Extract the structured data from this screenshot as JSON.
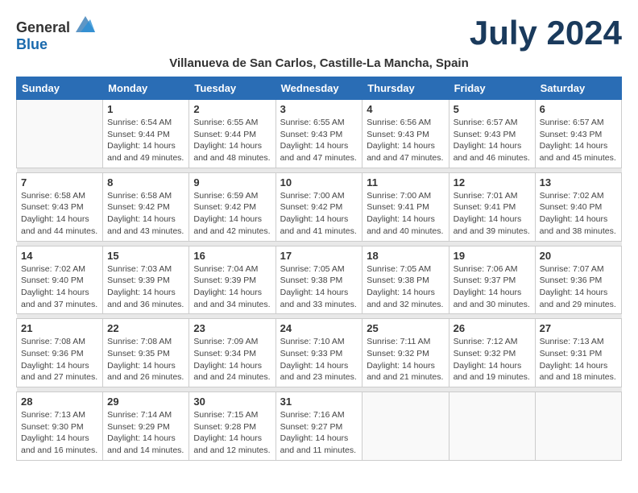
{
  "header": {
    "logo_general": "General",
    "logo_blue": "Blue",
    "month_title": "July 2024",
    "location": "Villanueva de San Carlos, Castille-La Mancha, Spain"
  },
  "days_of_week": [
    "Sunday",
    "Monday",
    "Tuesday",
    "Wednesday",
    "Thursday",
    "Friday",
    "Saturday"
  ],
  "weeks": [
    [
      {
        "day": "",
        "sunrise": "",
        "sunset": "",
        "daylight": ""
      },
      {
        "day": "1",
        "sunrise": "Sunrise: 6:54 AM",
        "sunset": "Sunset: 9:44 PM",
        "daylight": "Daylight: 14 hours and 49 minutes."
      },
      {
        "day": "2",
        "sunrise": "Sunrise: 6:55 AM",
        "sunset": "Sunset: 9:44 PM",
        "daylight": "Daylight: 14 hours and 48 minutes."
      },
      {
        "day": "3",
        "sunrise": "Sunrise: 6:55 AM",
        "sunset": "Sunset: 9:43 PM",
        "daylight": "Daylight: 14 hours and 47 minutes."
      },
      {
        "day": "4",
        "sunrise": "Sunrise: 6:56 AM",
        "sunset": "Sunset: 9:43 PM",
        "daylight": "Daylight: 14 hours and 47 minutes."
      },
      {
        "day": "5",
        "sunrise": "Sunrise: 6:57 AM",
        "sunset": "Sunset: 9:43 PM",
        "daylight": "Daylight: 14 hours and 46 minutes."
      },
      {
        "day": "6",
        "sunrise": "Sunrise: 6:57 AM",
        "sunset": "Sunset: 9:43 PM",
        "daylight": "Daylight: 14 hours and 45 minutes."
      }
    ],
    [
      {
        "day": "7",
        "sunrise": "Sunrise: 6:58 AM",
        "sunset": "Sunset: 9:43 PM",
        "daylight": "Daylight: 14 hours and 44 minutes."
      },
      {
        "day": "8",
        "sunrise": "Sunrise: 6:58 AM",
        "sunset": "Sunset: 9:42 PM",
        "daylight": "Daylight: 14 hours and 43 minutes."
      },
      {
        "day": "9",
        "sunrise": "Sunrise: 6:59 AM",
        "sunset": "Sunset: 9:42 PM",
        "daylight": "Daylight: 14 hours and 42 minutes."
      },
      {
        "day": "10",
        "sunrise": "Sunrise: 7:00 AM",
        "sunset": "Sunset: 9:42 PM",
        "daylight": "Daylight: 14 hours and 41 minutes."
      },
      {
        "day": "11",
        "sunrise": "Sunrise: 7:00 AM",
        "sunset": "Sunset: 9:41 PM",
        "daylight": "Daylight: 14 hours and 40 minutes."
      },
      {
        "day": "12",
        "sunrise": "Sunrise: 7:01 AM",
        "sunset": "Sunset: 9:41 PM",
        "daylight": "Daylight: 14 hours and 39 minutes."
      },
      {
        "day": "13",
        "sunrise": "Sunrise: 7:02 AM",
        "sunset": "Sunset: 9:40 PM",
        "daylight": "Daylight: 14 hours and 38 minutes."
      }
    ],
    [
      {
        "day": "14",
        "sunrise": "Sunrise: 7:02 AM",
        "sunset": "Sunset: 9:40 PM",
        "daylight": "Daylight: 14 hours and 37 minutes."
      },
      {
        "day": "15",
        "sunrise": "Sunrise: 7:03 AM",
        "sunset": "Sunset: 9:39 PM",
        "daylight": "Daylight: 14 hours and 36 minutes."
      },
      {
        "day": "16",
        "sunrise": "Sunrise: 7:04 AM",
        "sunset": "Sunset: 9:39 PM",
        "daylight": "Daylight: 14 hours and 34 minutes."
      },
      {
        "day": "17",
        "sunrise": "Sunrise: 7:05 AM",
        "sunset": "Sunset: 9:38 PM",
        "daylight": "Daylight: 14 hours and 33 minutes."
      },
      {
        "day": "18",
        "sunrise": "Sunrise: 7:05 AM",
        "sunset": "Sunset: 9:38 PM",
        "daylight": "Daylight: 14 hours and 32 minutes."
      },
      {
        "day": "19",
        "sunrise": "Sunrise: 7:06 AM",
        "sunset": "Sunset: 9:37 PM",
        "daylight": "Daylight: 14 hours and 30 minutes."
      },
      {
        "day": "20",
        "sunrise": "Sunrise: 7:07 AM",
        "sunset": "Sunset: 9:36 PM",
        "daylight": "Daylight: 14 hours and 29 minutes."
      }
    ],
    [
      {
        "day": "21",
        "sunrise": "Sunrise: 7:08 AM",
        "sunset": "Sunset: 9:36 PM",
        "daylight": "Daylight: 14 hours and 27 minutes."
      },
      {
        "day": "22",
        "sunrise": "Sunrise: 7:08 AM",
        "sunset": "Sunset: 9:35 PM",
        "daylight": "Daylight: 14 hours and 26 minutes."
      },
      {
        "day": "23",
        "sunrise": "Sunrise: 7:09 AM",
        "sunset": "Sunset: 9:34 PM",
        "daylight": "Daylight: 14 hours and 24 minutes."
      },
      {
        "day": "24",
        "sunrise": "Sunrise: 7:10 AM",
        "sunset": "Sunset: 9:33 PM",
        "daylight": "Daylight: 14 hours and 23 minutes."
      },
      {
        "day": "25",
        "sunrise": "Sunrise: 7:11 AM",
        "sunset": "Sunset: 9:32 PM",
        "daylight": "Daylight: 14 hours and 21 minutes."
      },
      {
        "day": "26",
        "sunrise": "Sunrise: 7:12 AM",
        "sunset": "Sunset: 9:32 PM",
        "daylight": "Daylight: 14 hours and 19 minutes."
      },
      {
        "day": "27",
        "sunrise": "Sunrise: 7:13 AM",
        "sunset": "Sunset: 9:31 PM",
        "daylight": "Daylight: 14 hours and 18 minutes."
      }
    ],
    [
      {
        "day": "28",
        "sunrise": "Sunrise: 7:13 AM",
        "sunset": "Sunset: 9:30 PM",
        "daylight": "Daylight: 14 hours and 16 minutes."
      },
      {
        "day": "29",
        "sunrise": "Sunrise: 7:14 AM",
        "sunset": "Sunset: 9:29 PM",
        "daylight": "Daylight: 14 hours and 14 minutes."
      },
      {
        "day": "30",
        "sunrise": "Sunrise: 7:15 AM",
        "sunset": "Sunset: 9:28 PM",
        "daylight": "Daylight: 14 hours and 12 minutes."
      },
      {
        "day": "31",
        "sunrise": "Sunrise: 7:16 AM",
        "sunset": "Sunset: 9:27 PM",
        "daylight": "Daylight: 14 hours and 11 minutes."
      },
      {
        "day": "",
        "sunrise": "",
        "sunset": "",
        "daylight": ""
      },
      {
        "day": "",
        "sunrise": "",
        "sunset": "",
        "daylight": ""
      },
      {
        "day": "",
        "sunrise": "",
        "sunset": "",
        "daylight": ""
      }
    ]
  ]
}
